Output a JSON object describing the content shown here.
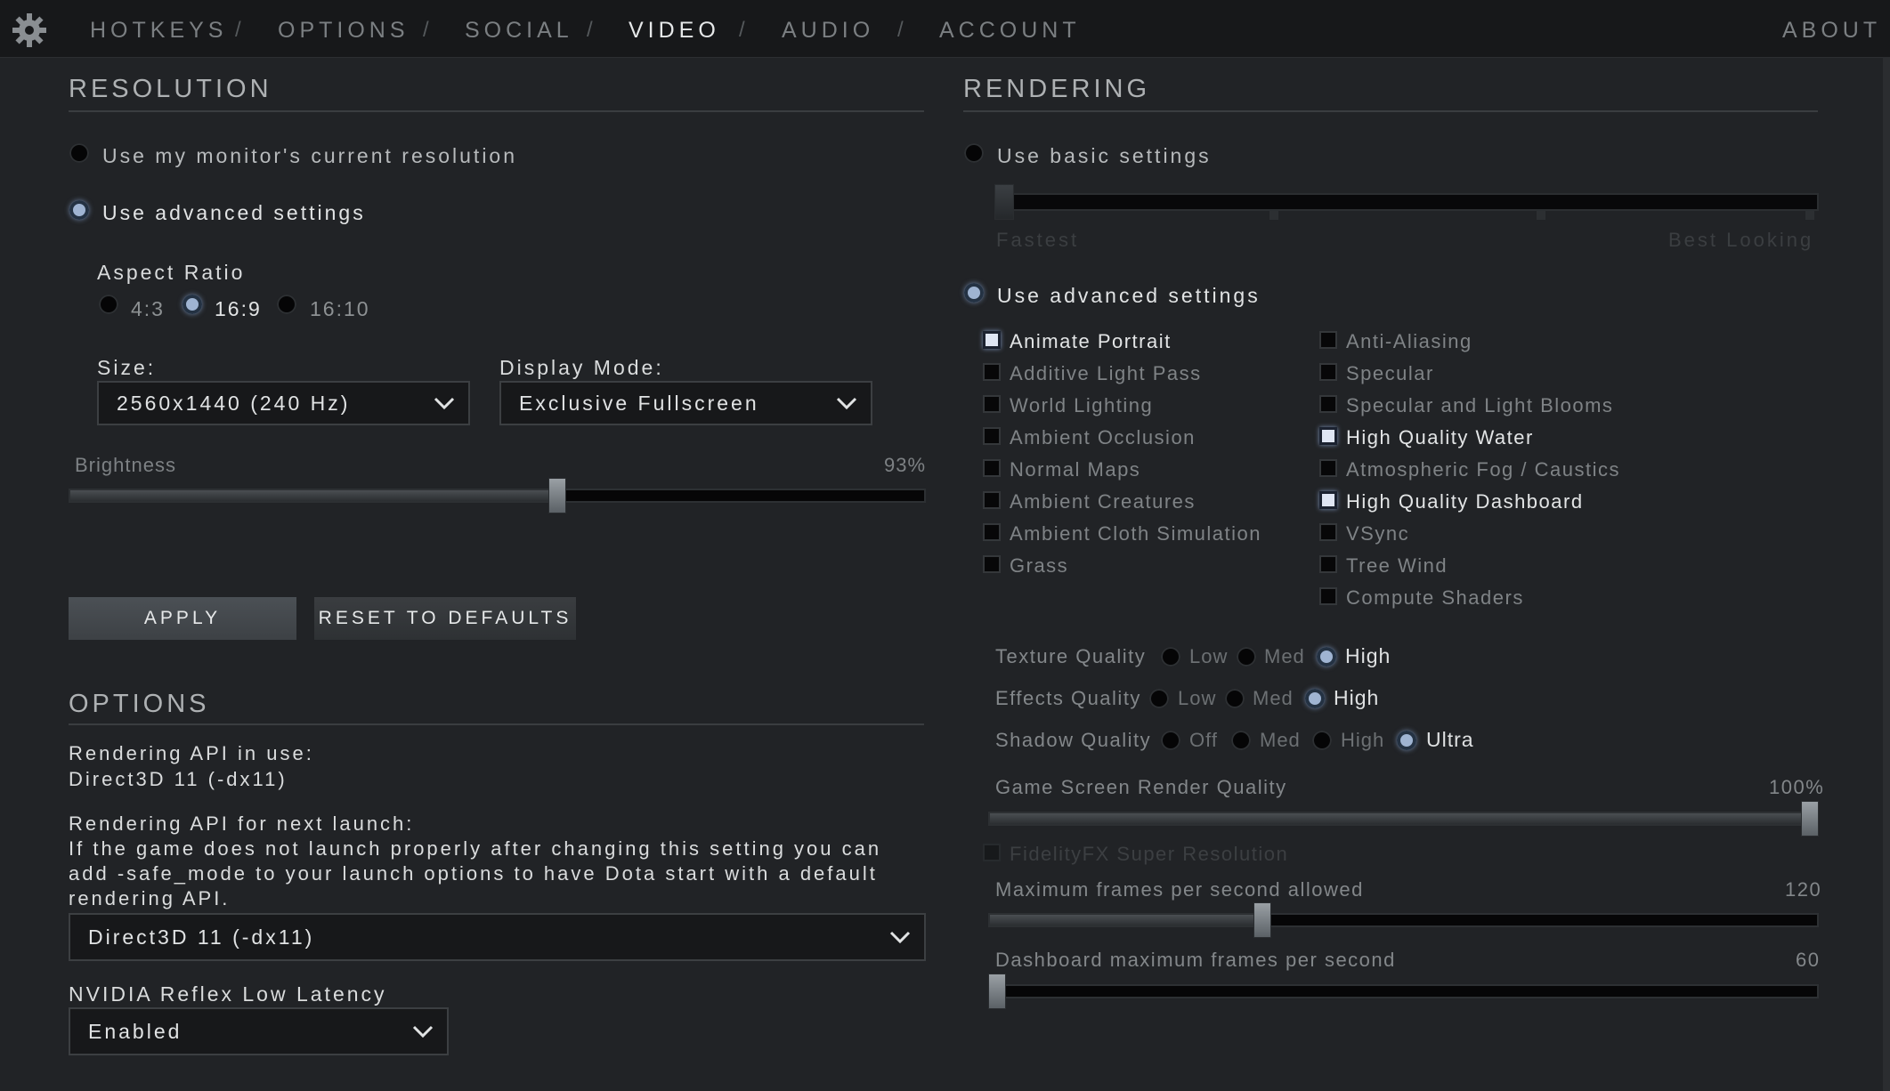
{
  "nav": {
    "tabs": [
      "HOTKEYS",
      "OPTIONS",
      "SOCIAL",
      "VIDEO",
      "AUDIO",
      "ACCOUNT"
    ],
    "separator": "/",
    "about": "ABOUT",
    "active_tab": "VIDEO"
  },
  "resolution": {
    "title": "RESOLUTION",
    "monitor_option": "Use my monitor's current resolution",
    "advanced_option": "Use advanced settings",
    "aspect_label": "Aspect Ratio",
    "aspect_options": [
      "4:3",
      "16:9",
      "16:10"
    ],
    "aspect_selected": "16:9",
    "size_label": "Size:",
    "size_value": "2560x1440 (240 Hz)",
    "mode_label": "Display Mode:",
    "mode_value": "Exclusive Fullscreen",
    "brightness_label": "Brightness",
    "brightness_value": "93%",
    "brightness_fraction": 0.57
  },
  "buttons": {
    "apply": "APPLY",
    "reset": "RESET TO DEFAULTS"
  },
  "options": {
    "title": "OPTIONS",
    "api_in_use_label": "Rendering API in use:",
    "api_in_use_value": "Direct3D 11 (-dx11)",
    "api_next_label": "Rendering API for next launch:",
    "api_note_1": "If the game does not launch properly after changing this setting you can",
    "api_note_2": "add -safe_mode to your launch options to have Dota start with a default",
    "api_note_3": "rendering API.",
    "api_select_value": "Direct3D 11 (-dx11)",
    "reflex_label": "NVIDIA Reflex Low Latency",
    "reflex_value": "Enabled"
  },
  "rendering": {
    "title": "RENDERING",
    "basic_option": "Use basic settings",
    "basic_left": "Fastest",
    "basic_right": "Best Looking",
    "advanced_option": "Use advanced settings",
    "checkboxes_left": [
      {
        "label": "Animate Portrait",
        "checked": true
      },
      {
        "label": "Additive Light Pass",
        "checked": false
      },
      {
        "label": "World Lighting",
        "checked": false
      },
      {
        "label": "Ambient Occlusion",
        "checked": false
      },
      {
        "label": "Normal Maps",
        "checked": false
      },
      {
        "label": "Ambient Creatures",
        "checked": false
      },
      {
        "label": "Ambient Cloth Simulation",
        "checked": false
      },
      {
        "label": "Grass",
        "checked": false
      }
    ],
    "checkboxes_right": [
      {
        "label": "Anti-Aliasing",
        "checked": false
      },
      {
        "label": "Specular",
        "checked": false
      },
      {
        "label": "Specular and Light Blooms",
        "checked": false
      },
      {
        "label": "High Quality Water",
        "checked": true
      },
      {
        "label": "Atmospheric Fog / Caustics",
        "checked": false
      },
      {
        "label": "High Quality Dashboard",
        "checked": true
      },
      {
        "label": "VSync",
        "checked": false
      },
      {
        "label": "Tree Wind",
        "checked": false
      },
      {
        "label": "Compute Shaders",
        "checked": false
      }
    ],
    "texture_label": "Texture Quality",
    "texture_options": [
      "Low",
      "Med",
      "High"
    ],
    "texture_selected": "High",
    "effects_label": "Effects Quality",
    "effects_options": [
      "Low",
      "Med",
      "High"
    ],
    "effects_selected": "High",
    "shadow_label": "Shadow Quality",
    "shadow_options": [
      "Off",
      "Med",
      "High",
      "Ultra"
    ],
    "shadow_selected": "Ultra",
    "render_quality_label": "Game Screen Render Quality",
    "render_quality_value": "100%",
    "render_quality_fraction": 1.0,
    "fsr_label": "FidelityFX Super Resolution",
    "max_fps_label": "Maximum frames per second allowed",
    "max_fps_value": "120",
    "max_fps_fraction": 0.33,
    "dash_fps_label": "Dashboard maximum frames per second",
    "dash_fps_value": "60",
    "dash_fps_fraction": 0.0
  }
}
